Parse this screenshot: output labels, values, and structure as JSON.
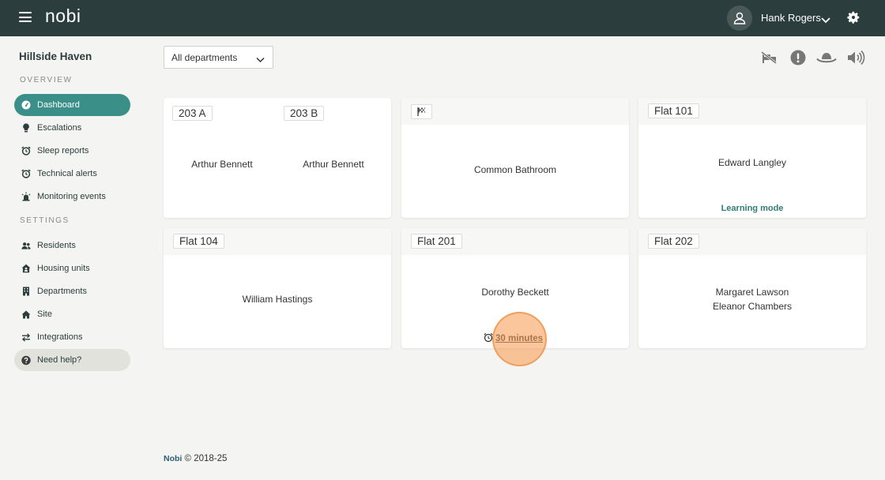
{
  "header": {
    "logo": "nobi",
    "user_name": "Hank Rogers",
    "icons": {
      "menu": "hamburger-icon",
      "avatar": "user-icon",
      "dropdown": "chevron-down-icon",
      "settings": "gear-icon"
    }
  },
  "sidebar": {
    "site_name": "Hillside Haven",
    "overview_label": "OVERVIEW",
    "settings_label": "SETTINGS",
    "overview_items": [
      {
        "label": "Dashboard",
        "icon": "gauge-icon"
      },
      {
        "label": "Escalations",
        "icon": "lightbulb-icon"
      },
      {
        "label": "Sleep reports",
        "icon": "alarm-clock-icon"
      },
      {
        "label": "Technical alerts",
        "icon": "alarm-clock-icon"
      },
      {
        "label": "Monitoring events",
        "icon": "siren-icon"
      }
    ],
    "settings_items": [
      {
        "label": "Residents",
        "icon": "users-icon"
      },
      {
        "label": "Housing units",
        "icon": "house-user-icon"
      },
      {
        "label": "Departments",
        "icon": "building-icon"
      },
      {
        "label": "Site",
        "icon": "home-icon"
      },
      {
        "label": "Integrations",
        "icon": "arrows-icon"
      }
    ],
    "help": {
      "label": "Need help?",
      "icon": "question-icon"
    }
  },
  "toolbar": {
    "department_filter": "All departments",
    "icons": [
      "bed-off-icon",
      "alert-icon",
      "hat-icon",
      "volume-icon"
    ]
  },
  "cards": {
    "c1": {
      "tag_a": "203 A",
      "tag_b": "203 B",
      "resident_a": "Arthur Bennett",
      "resident_b": "Arthur Bennett"
    },
    "c2": {
      "icon": "flag-icon",
      "resident": "Common Bathroom"
    },
    "c3": {
      "tag": "Flat 101",
      "resident": "Edward Langley",
      "status": "Learning mode"
    },
    "c4": {
      "tag": "Flat 104",
      "resident": "William Hastings"
    },
    "c5": {
      "tag": "Flat 201",
      "resident": "Dorothy Beckett",
      "timer": "30 minutes"
    },
    "c6": {
      "tag": "Flat 202",
      "resident_1": "Margaret Lawson",
      "resident_2": "Eleanor Chambers"
    }
  },
  "footer": {
    "brand": "Nobi",
    "copyright": "© 2018-25"
  },
  "colors": {
    "topbar": "#2b3d3c",
    "accent": "#3a8f88",
    "learning": "#2f7d77",
    "background": "#f4f4f2"
  }
}
